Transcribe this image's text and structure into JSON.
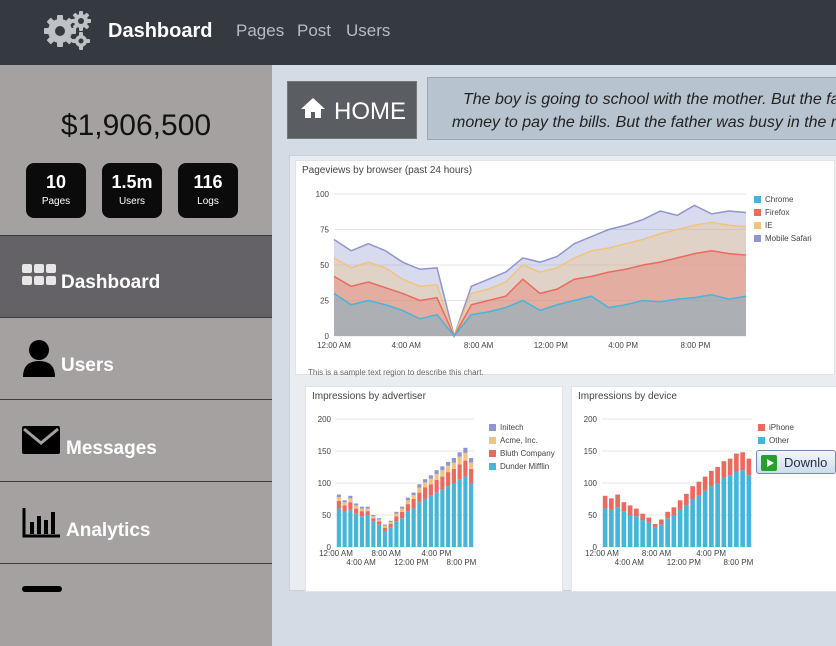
{
  "header": {
    "brand": "Dashboard",
    "logo_icon": "gears-icon",
    "nav": [
      "Pages",
      "Post",
      "Users"
    ]
  },
  "sidebar": {
    "balance": "$1,906,500",
    "stats": [
      {
        "value": "10",
        "label": "Pages"
      },
      {
        "value": "1.5m",
        "label": "Users"
      },
      {
        "value": "116",
        "label": "Logs"
      }
    ],
    "items": [
      {
        "label": "Dashboard",
        "icon": "grid-icon",
        "active": true
      },
      {
        "label": "Users",
        "icon": "user-icon",
        "active": false
      },
      {
        "label": "Messages",
        "icon": "envelope-icon",
        "active": false
      },
      {
        "label": "Analytics",
        "icon": "bar-chart-icon",
        "active": false
      }
    ]
  },
  "main": {
    "home_label": "HOME",
    "home_icon": "home-icon",
    "quote_line1": "The boy is going to school with the mother. But the fa",
    "quote_line2": "money to pay the bills. But the father was busy in the n",
    "download_label": "Downlo",
    "chart_note": "This is a sample text region to describe this chart."
  },
  "colors": {
    "topbar": "#343a40",
    "sidebar": "#a5a1a1",
    "active": "#646266",
    "mobile_safari": "#8f95cf",
    "ie": "#f1c37e",
    "firefox": "#ea6a5e",
    "chrome": "#45b6d9"
  },
  "chart_data": [
    {
      "type": "area",
      "title": "Pageviews by browser (past 24 hours)",
      "x_ticks": [
        "12:00 AM",
        "4:00 AM",
        "8:00 AM",
        "12:00 PM",
        "4:00 PM",
        "8:00 PM"
      ],
      "ylim": [
        0,
        100
      ],
      "y_ticks": [
        0,
        25,
        50,
        75,
        100
      ],
      "legend": "right",
      "series": [
        {
          "name": "Chrome",
          "values": [
            30,
            22,
            25,
            22,
            18,
            12,
            15,
            0,
            15,
            17,
            20,
            25,
            18,
            22,
            25,
            28,
            20,
            22,
            25,
            24,
            26,
            27,
            29,
            26,
            28
          ]
        },
        {
          "name": "Firefox",
          "values": [
            42,
            35,
            38,
            34,
            30,
            25,
            27,
            0,
            22,
            25,
            28,
            40,
            30,
            33,
            40,
            42,
            45,
            47,
            50,
            52,
            55,
            58,
            60,
            58,
            57
          ]
        },
        {
          "name": "IE",
          "values": [
            55,
            48,
            52,
            48,
            40,
            35,
            36,
            0,
            30,
            33,
            38,
            50,
            45,
            48,
            55,
            60,
            62,
            65,
            68,
            72,
            75,
            78,
            80,
            78,
            77
          ]
        },
        {
          "name": "Mobile Safari",
          "values": [
            68,
            60,
            65,
            60,
            52,
            47,
            48,
            0,
            35,
            40,
            45,
            55,
            52,
            56,
            65,
            70,
            75,
            78,
            82,
            88,
            85,
            92,
            86,
            88,
            87
          ]
        }
      ]
    },
    {
      "type": "bar",
      "title": "Impressions by advertiser",
      "x_ticks": [
        "12:00 AM",
        "4:00 AM",
        "8:00 AM",
        "12:00 PM",
        "4:00 PM",
        "8:00 PM"
      ],
      "ylim": [
        0,
        200
      ],
      "y_ticks": [
        0,
        50,
        100,
        150,
        200
      ],
      "legend": "right",
      "series": [
        {
          "name": "Dunder Mifflin",
          "values": [
            60,
            55,
            58,
            52,
            48,
            50,
            40,
            35,
            25,
            30,
            40,
            45,
            55,
            60,
            70,
            75,
            80,
            85,
            90,
            95,
            100,
            105,
            110,
            100
          ]
        },
        {
          "name": "Bluth Company",
          "values": [
            12,
            10,
            12,
            8,
            8,
            6,
            5,
            5,
            5,
            6,
            8,
            10,
            12,
            15,
            15,
            18,
            18,
            20,
            20,
            22,
            22,
            24,
            25,
            22
          ]
        },
        {
          "name": "Acme, Inc.",
          "values": [
            6,
            5,
            6,
            5,
            4,
            4,
            3,
            3,
            3,
            3,
            4,
            5,
            6,
            6,
            8,
            8,
            9,
            9,
            10,
            10,
            10,
            12,
            12,
            10
          ]
        },
        {
          "name": "Initech",
          "values": [
            4,
            3,
            4,
            3,
            3,
            3,
            2,
            2,
            2,
            2,
            3,
            3,
            4,
            4,
            5,
            5,
            5,
            6,
            6,
            6,
            7,
            7,
            8,
            7
          ]
        }
      ]
    },
    {
      "type": "bar",
      "title": "Impressions by device",
      "x_ticks": [
        "12:00 AM",
        "4:00 AM",
        "8:00 AM",
        "12:00 PM",
        "4:00 PM",
        "8:00 PM"
      ],
      "ylim": [
        0,
        200
      ],
      "y_ticks": [
        0,
        50,
        100,
        150,
        200
      ],
      "legend": "right",
      "series": [
        {
          "name": "Other",
          "values": [
            60,
            58,
            62,
            55,
            50,
            48,
            42,
            38,
            30,
            35,
            45,
            50,
            58,
            65,
            75,
            80,
            88,
            95,
            100,
            108,
            112,
            118,
            120,
            112
          ]
        },
        {
          "name": "iPhone",
          "values": [
            20,
            18,
            20,
            15,
            15,
            12,
            10,
            8,
            6,
            8,
            10,
            12,
            15,
            18,
            20,
            22,
            22,
            24,
            25,
            26,
            26,
            28,
            28,
            26
          ]
        }
      ]
    }
  ]
}
